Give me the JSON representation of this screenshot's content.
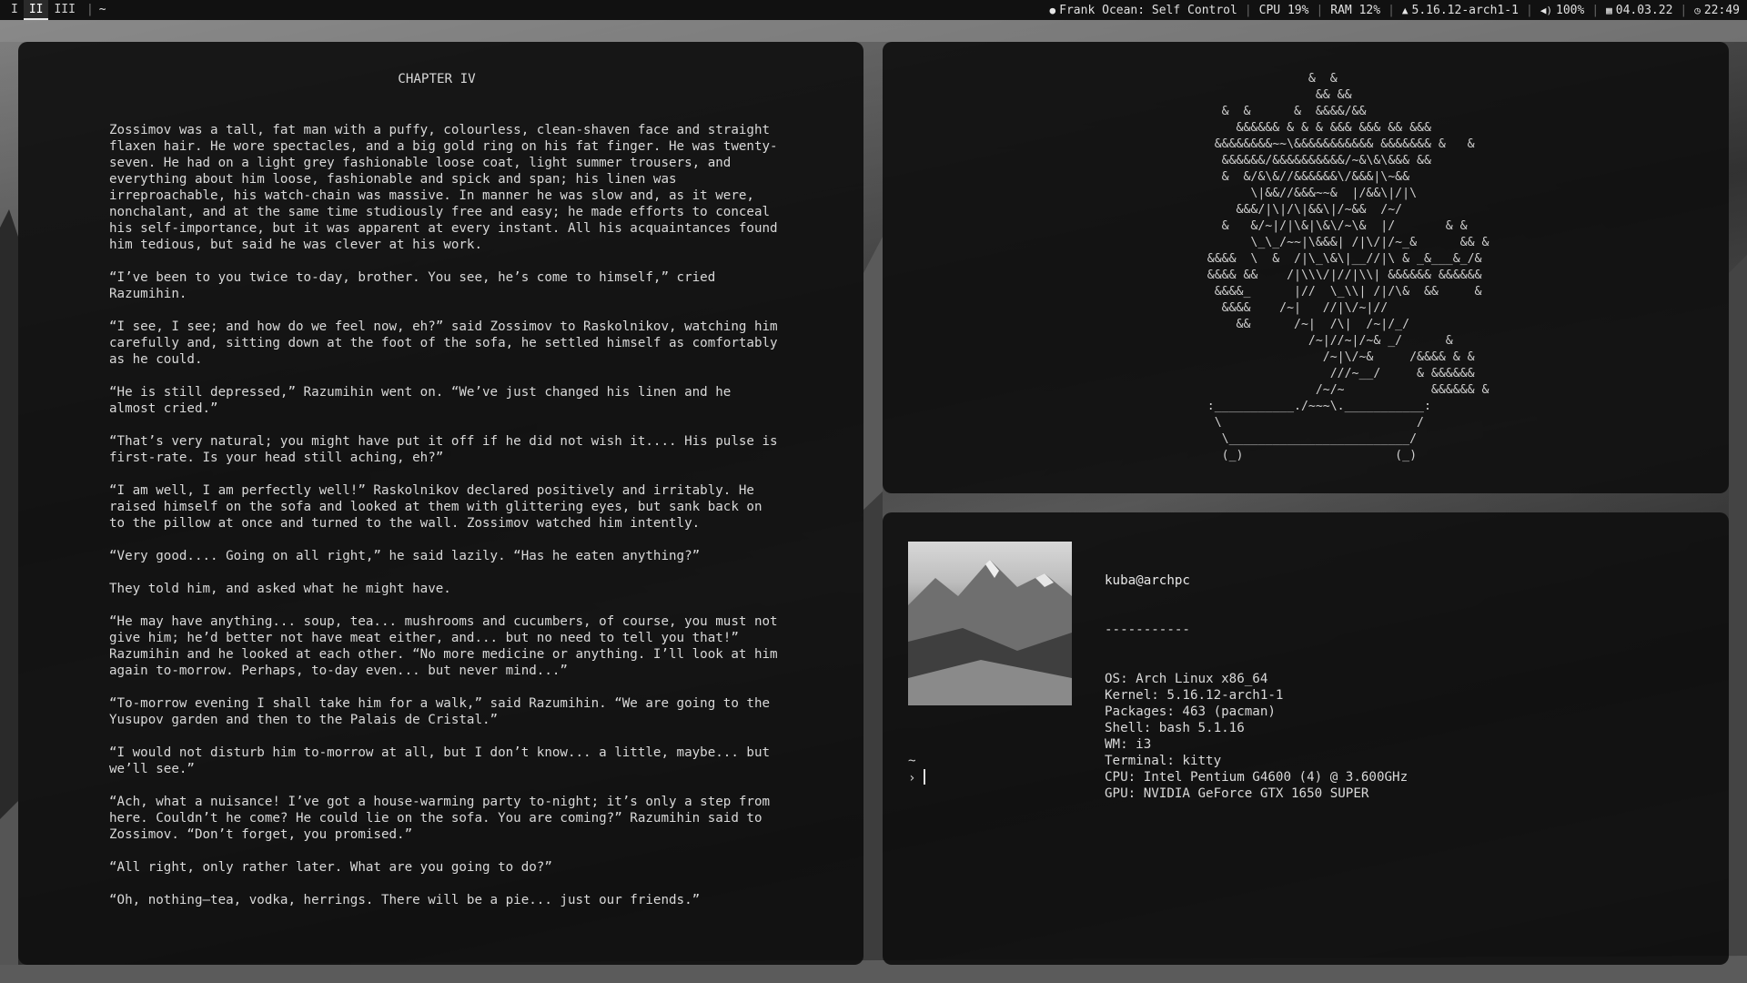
{
  "topbar": {
    "workspaces": [
      "I",
      "II",
      "III"
    ],
    "active_workspace": "II",
    "window_title": "~",
    "status": {
      "music": "Frank Ocean: Self Control",
      "cpu": "CPU 19%",
      "ram": "RAM 12%",
      "kernel": "5.16.12-arch1-1",
      "volume": "100%",
      "date": "04.03.22",
      "time": "22:49"
    }
  },
  "reader": {
    "chapter": "CHAPTER IV",
    "paragraphs": [
      "Zossimov was a tall, fat man with a puffy, colourless, clean-shaven face and straight flaxen hair. He wore spectacles, and a big gold ring on his fat finger. He was twenty-seven. He had on a light grey fashionable loose coat, light summer trousers, and everything about him loose, fashionable and spick and span; his linen was irreproachable, his watch-chain was massive. In manner he was slow and, as it were, nonchalant, and at the same time studiously free and easy; he made efforts to conceal his self-importance, but it was apparent at every instant. All his acquaintances found him tedious, but said he was clever at his work.",
      "“I’ve been to you twice to-day, brother. You see, he’s come to himself,” cried Razumihin.",
      "“I see, I see; and how do we feel now, eh?” said Zossimov to Raskolnikov, watching him carefully and, sitting down at the foot of the sofa, he settled himself as comfortably as he could.",
      "“He is still depressed,” Razumihin went on. “We’ve just changed his linen and he almost cried.”",
      "“That’s very natural; you might have put it off if he did not wish it.... His pulse is first-rate. Is your head still aching, eh?”",
      "“I am well, I am perfectly well!” Raskolnikov declared positively and irritably. He raised himself on the sofa and looked at them with glittering eyes, but sank back on to the pillow at once and turned to the wall. Zossimov watched him intently.",
      "“Very good.... Going on all right,” he said lazily. “Has he eaten anything?”",
      "They told him, and asked what he might have.",
      "“He may have anything... soup, tea... mushrooms and cucumbers, of course, you must not give him; he’d better not have meat either, and... but no need to tell you that!” Razumihin and he looked at each other. “No more medicine or anything. I’ll look at him again to-morrow. Perhaps, to-day even... but never mind...”",
      "“To-morrow evening I shall take him for a walk,” said Razumihin. “We are going to the Yusupov garden and then to the Palais de Cristal.”",
      "“I would not disturb him to-morrow at all, but I don’t know... a little, maybe... but we’ll see.”",
      "“Ach, what a nuisance! I’ve got a house-warming party to-night; it’s only a step from here. Couldn’t he come? He could lie on the sofa. You are coming?” Razumihin said to Zossimov. “Don’t forget, you promised.”",
      "“All right, only rather later. What are you going to do?”",
      "“Oh, nothing—tea, vodka, herrings. There will be a pie... just our friends.”"
    ]
  },
  "ascii_art": "                  &  &\n                   && &&\n      &  &      &  &&&&/&&\n        &&&&&& & & & &&& &&& && &&&\n     &&&&&&&&~~\\&&&&&&&&&&& &&&&&&& &   &\n      &&&&&&/&&&&&&&&&&/~&\\&\\&&& &&\n      &  &/&\\&//&&&&&&\\/&&&|\\~&&\n          \\|&&//&&&~~&  |/&&\\|/|\\\n        &&&/|\\|/\\|&&\\|/~&&  /~/\n      &   &/~|/|\\&|\\&\\/~\\&  |/       & &\n          \\_\\_/~~|\\&&&| /|\\/|/~_&      && &\n    &&&&  \\  &  /|\\_\\&\\|__//|\\ & _&___&_/&\n    &&&& &&    /|\\\\\\/|//|\\\\| &&&&&& &&&&&&\n     &&&&_      |//  \\_\\\\| /|/\\&  &&     &\n      &&&&    /~|   //|\\/~|//\n        &&      /~|  /\\|  /~|/_/\n                  /~|//~|/~& _/      &\n                    /~|\\/~&     /&&&& & &\n                     ///~__/     & &&&&&&\n                   /~/~            &&&&&& &\n    :___________./~~~\\.___________:\n     \\                           /\n      \\_________________________/\n      (_)                     (_)",
  "fetch": {
    "user_host": "kuba@archpc",
    "divider": "-----------",
    "lines": [
      "OS: Arch Linux x86_64",
      "Kernel: 5.16.12-arch1-1",
      "Packages: 463 (pacman)",
      "Shell: bash 5.1.16",
      "WM: i3",
      "Terminal: kitty",
      "CPU: Intel Pentium G4600 (4) @ 3.600GHz",
      "GPU: NVIDIA GeForce GTX 1650 SUPER"
    ],
    "cwd": "~",
    "prompt_symbol": "›"
  }
}
